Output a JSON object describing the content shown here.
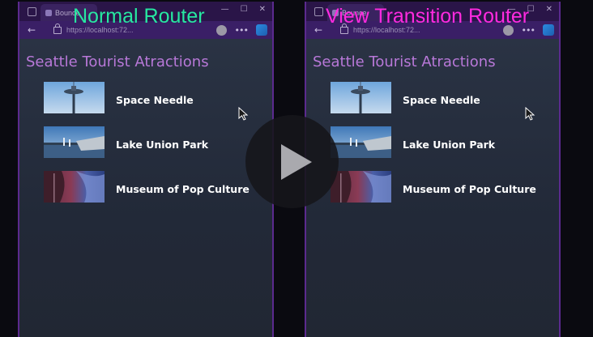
{
  "captions": {
    "left": "Normal Router",
    "right": "View Transition Router"
  },
  "browser": {
    "tab_title": "Bounce",
    "url": "https://localhost:72...",
    "window_controls": [
      "—",
      "☐",
      "✕"
    ],
    "more_label": "•••"
  },
  "page": {
    "title": "Seattle Tourist Atractions",
    "attractions": [
      {
        "name": "Space Needle",
        "thumb_icon": "space-needle-photo"
      },
      {
        "name": "Lake Union Park",
        "thumb_icon": "lake-union-park-photo"
      },
      {
        "name": "Museum of Pop Culture",
        "thumb_icon": "museum-of-pop-culture-photo"
      }
    ]
  },
  "icons": {
    "play": "play-icon",
    "cursor": "mouse-cursor-icon",
    "back": "back-arrow-icon"
  },
  "colors": {
    "caption_left": "#27e8a1",
    "caption_right": "#ff2ae0",
    "title": "#b878d8",
    "browser_chrome": "#3a1f66",
    "page_bg": "#212733"
  }
}
